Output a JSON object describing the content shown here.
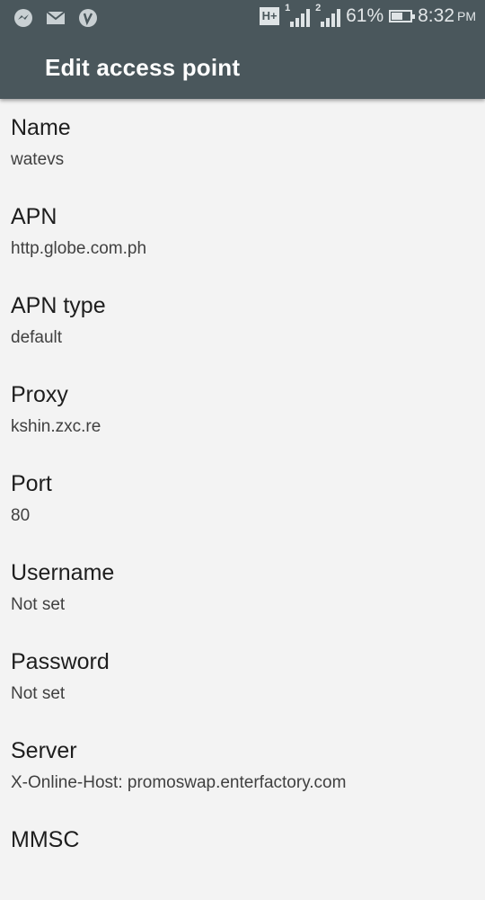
{
  "status_bar": {
    "left_icons": [
      "messenger-icon",
      "gmail-icon",
      "vpn-icon"
    ],
    "network_type": "H+",
    "sim1_label": "1",
    "sim2_label": "2",
    "battery_percent": "61%",
    "battery_level": 0.61,
    "time": "8:32",
    "ampm": "PM"
  },
  "header": {
    "title": "Edit access point"
  },
  "settings": [
    {
      "label": "Name",
      "value": "watevs"
    },
    {
      "label": "APN",
      "value": "http.globe.com.ph"
    },
    {
      "label": "APN type",
      "value": "default"
    },
    {
      "label": "Proxy",
      "value": "kshin.zxc.re"
    },
    {
      "label": "Port",
      "value": "80"
    },
    {
      "label": "Username",
      "value": "Not set"
    },
    {
      "label": "Password",
      "value": "Not set"
    },
    {
      "label": "Server",
      "value": "X-Online-Host: promoswap.enterfactory.com"
    },
    {
      "label": "MMSC",
      "value": ""
    }
  ]
}
